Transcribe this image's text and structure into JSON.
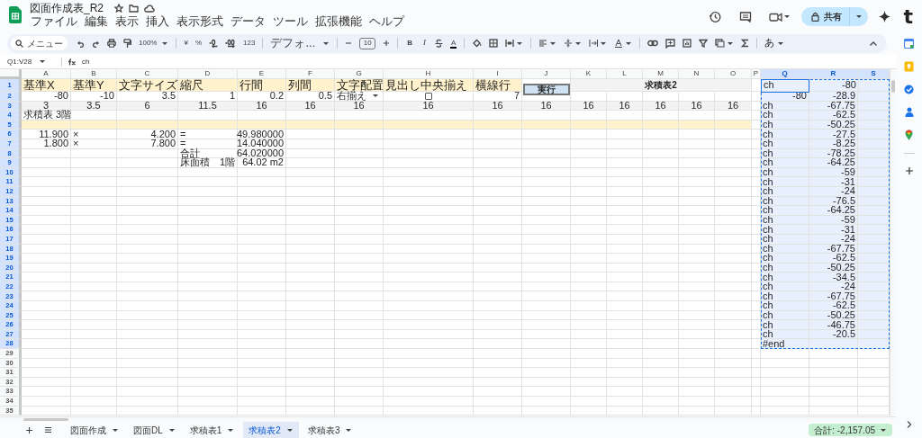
{
  "document": {
    "title": "図面作成表_R2"
  },
  "menu": [
    "ファイル",
    "編集",
    "表示",
    "挿入",
    "表示形式",
    "データ",
    "ツール",
    "拡張機能",
    "ヘルプ"
  ],
  "share": {
    "label": "共有"
  },
  "account": {
    "initial": "t"
  },
  "toolbar": {
    "search": "メニュー",
    "zoom": "100%",
    "currency": "¥",
    "percent": "%",
    "number_format": "123",
    "font": "デフォ...",
    "font_size": "10",
    "bold": "B",
    "italic": "I",
    "text_color": "A",
    "input_tool": "あ"
  },
  "formula_bar": {
    "range": "Q1:V28",
    "formula": "ch"
  },
  "columns": [
    {
      "label": "A",
      "selected": false
    },
    {
      "label": "B",
      "selected": false
    },
    {
      "label": "C",
      "selected": false
    },
    {
      "label": "D",
      "selected": false
    },
    {
      "label": "E",
      "selected": false
    },
    {
      "label": "F",
      "selected": false
    },
    {
      "label": "G",
      "selected": false
    },
    {
      "label": "H",
      "selected": false
    },
    {
      "label": "I",
      "selected": false
    },
    {
      "label": "J",
      "selected": false
    },
    {
      "label": "K",
      "selected": false
    },
    {
      "label": "L",
      "selected": false
    },
    {
      "label": "M",
      "selected": false
    },
    {
      "label": "N",
      "selected": false
    },
    {
      "label": "O",
      "selected": false
    },
    {
      "label": "P",
      "selected": false
    },
    {
      "label": "Q",
      "selected": true
    },
    {
      "label": "R",
      "selected": true
    },
    {
      "label": "S",
      "selected": true
    }
  ],
  "rows": [
    {
      "number": "1",
      "selected": true,
      "kind": "header",
      "banner": "求積表2",
      "button": "実行",
      "cells": [
        {
          "text": "基準X"
        },
        {
          "text": "基準Y"
        },
        {
          "text": "文字サイズ"
        },
        {
          "text": "縮尺"
        },
        {
          "text": "行間"
        },
        {
          "text": "列間"
        },
        {
          "text": "文字配置"
        },
        {
          "text": "見出し中央揃え"
        },
        {
          "text": "横線行"
        }
      ],
      "range_cells": [
        {
          "text": "ch"
        },
        {
          "text": "-80",
          "kind": "number"
        }
      ]
    },
    {
      "number": "2",
      "selected": true,
      "cells": [
        {
          "text": "-80",
          "kind": "number"
        },
        {
          "text": "-10",
          "kind": "number"
        },
        {
          "text": "3.5",
          "kind": "number"
        },
        {
          "text": "1",
          "kind": "number"
        },
        {
          "text": "0.2",
          "kind": "number"
        },
        {
          "text": "0.5",
          "kind": "number"
        },
        {
          "kind": "dropdown",
          "text": "右揃え"
        },
        {
          "kind": "checkbox",
          "checked": false
        },
        {
          "text": "7",
          "kind": "number"
        }
      ],
      "range_cells": [
        {
          "text": "-80",
          "kind": "number"
        },
        {
          "text": "-28.9",
          "kind": "number"
        }
      ]
    },
    {
      "number": "3",
      "selected": true,
      "kind": "shaded",
      "cells": [
        {
          "text": "3"
        },
        {
          "text": "3.5"
        },
        {
          "text": "6"
        },
        {
          "text": "11.5"
        },
        {
          "text": "16"
        },
        {
          "text": "16"
        },
        {
          "text": "16"
        },
        {
          "text": "16"
        },
        {
          "text": "16"
        },
        {
          "text": "16"
        },
        {
          "text": "16"
        },
        {
          "text": "16"
        },
        {
          "text": "16"
        },
        {
          "text": "16"
        },
        {
          "text": "16"
        }
      ],
      "range_cells": [
        {
          "text": "ch"
        },
        {
          "text": "-67.75",
          "kind": "number"
        }
      ]
    },
    {
      "number": "4",
      "selected": true,
      "cells": [
        {
          "text": "求積表 3階"
        }
      ],
      "range_cells": [
        {
          "text": "ch"
        },
        {
          "text": "-62.5",
          "kind": "number"
        }
      ]
    },
    {
      "number": "5",
      "selected": true,
      "kind": "band",
      "range_cells": [
        {
          "text": "ch"
        },
        {
          "text": "-50.25",
          "kind": "number"
        }
      ]
    },
    {
      "number": "6",
      "selected": true,
      "cells": [
        {
          "text": "11.900",
          "kind": "number"
        },
        {
          "text": "×"
        },
        {
          "text": "4.200",
          "kind": "number"
        },
        {
          "text": "="
        },
        {
          "text": "49.980000",
          "kind": "number"
        }
      ],
      "range_cells": [
        {
          "text": "ch"
        },
        {
          "text": "-27.5",
          "kind": "number"
        }
      ]
    },
    {
      "number": "7",
      "selected": true,
      "cells": [
        {
          "text": "1.800",
          "kind": "number"
        },
        {
          "text": "×"
        },
        {
          "text": "7.800",
          "kind": "number"
        },
        {
          "text": "="
        },
        {
          "text": "14.040000",
          "kind": "number"
        }
      ],
      "range_cells": [
        {
          "text": "ch"
        },
        {
          "text": "-8.25",
          "kind": "number"
        }
      ]
    },
    {
      "number": "8",
      "selected": true,
      "cells": [
        {},
        {},
        {},
        {
          "text": "合計"
        },
        {
          "text": "64.020000",
          "kind": "number"
        }
      ],
      "range_cells": [
        {
          "text": "ch"
        },
        {
          "text": "-78.25",
          "kind": "number"
        }
      ]
    },
    {
      "number": "9",
      "selected": true,
      "cells": [
        {},
        {},
        {},
        {
          "text": "床面積　1階"
        },
        {
          "text": "64.02 m2",
          "kind": "number"
        }
      ],
      "range_cells": [
        {
          "text": "ch"
        },
        {
          "text": "-64.25",
          "kind": "number"
        }
      ]
    },
    {
      "number": "10",
      "selected": true,
      "range_cells": [
        {
          "text": "ch"
        },
        {
          "text": "-59",
          "kind": "number"
        }
      ]
    },
    {
      "number": "11",
      "selected": true,
      "range_cells": [
        {
          "text": "ch"
        },
        {
          "text": "-31",
          "kind": "number"
        }
      ]
    },
    {
      "number": "12",
      "selected": true,
      "range_cells": [
        {
          "text": "ch"
        },
        {
          "text": "-24",
          "kind": "number"
        }
      ]
    },
    {
      "number": "13",
      "selected": true,
      "range_cells": [
        {
          "text": "ch"
        },
        {
          "text": "-76.5",
          "kind": "number"
        }
      ]
    },
    {
      "number": "14",
      "selected": true,
      "range_cells": [
        {
          "text": "ch"
        },
        {
          "text": "-64.25",
          "kind": "number"
        }
      ]
    },
    {
      "number": "15",
      "selected": true,
      "range_cells": [
        {
          "text": "ch"
        },
        {
          "text": "-59",
          "kind": "number"
        }
      ]
    },
    {
      "number": "16",
      "selected": true,
      "range_cells": [
        {
          "text": "ch"
        },
        {
          "text": "-31",
          "kind": "number"
        }
      ]
    },
    {
      "number": "17",
      "selected": true,
      "range_cells": [
        {
          "text": "ch"
        },
        {
          "text": "-24",
          "kind": "number"
        }
      ]
    },
    {
      "number": "18",
      "selected": true,
      "range_cells": [
        {
          "text": "ch"
        },
        {
          "text": "-67.75",
          "kind": "number"
        }
      ]
    },
    {
      "number": "19",
      "selected": true,
      "range_cells": [
        {
          "text": "ch"
        },
        {
          "text": "-62.5",
          "kind": "number"
        }
      ]
    },
    {
      "number": "20",
      "selected": true,
      "range_cells": [
        {
          "text": "ch"
        },
        {
          "text": "-50.25",
          "kind": "number"
        }
      ]
    },
    {
      "number": "21",
      "selected": true,
      "range_cells": [
        {
          "text": "ch"
        },
        {
          "text": "-34.5",
          "kind": "number"
        }
      ]
    },
    {
      "number": "22",
      "selected": true,
      "range_cells": [
        {
          "text": "ch"
        },
        {
          "text": "-24",
          "kind": "number"
        }
      ]
    },
    {
      "number": "23",
      "selected": true,
      "range_cells": [
        {
          "text": "ch"
        },
        {
          "text": "-67.75",
          "kind": "number"
        }
      ]
    },
    {
      "number": "24",
      "selected": true,
      "range_cells": [
        {
          "text": "ch"
        },
        {
          "text": "-62.5",
          "kind": "number"
        }
      ]
    },
    {
      "number": "25",
      "selected": true,
      "range_cells": [
        {
          "text": "ch"
        },
        {
          "text": "-50.25",
          "kind": "number"
        }
      ]
    },
    {
      "number": "26",
      "selected": true,
      "range_cells": [
        {
          "text": "ch"
        },
        {
          "text": "-46.75",
          "kind": "number"
        }
      ]
    },
    {
      "number": "27",
      "selected": true,
      "range_cells": [
        {
          "text": "ch"
        },
        {
          "text": "-20.5",
          "kind": "number"
        }
      ]
    },
    {
      "number": "28",
      "selected": true,
      "range_cells": [
        {
          "text": "#end"
        }
      ]
    },
    {
      "number": "29",
      "selected": false
    },
    {
      "number": "30",
      "selected": false
    },
    {
      "number": "31",
      "selected": false
    },
    {
      "number": "32",
      "selected": false
    },
    {
      "number": "33",
      "selected": false
    },
    {
      "number": "34",
      "selected": false
    },
    {
      "number": "35",
      "selected": false
    }
  ],
  "sheet_tabs": [
    {
      "label": "図面作成",
      "selected": false
    },
    {
      "label": "図面DL",
      "selected": false
    },
    {
      "label": "求積表1",
      "selected": false
    },
    {
      "label": "求積表2",
      "selected": true
    },
    {
      "label": "求積表3",
      "selected": false
    }
  ],
  "summary": "合計: -2,157.05"
}
